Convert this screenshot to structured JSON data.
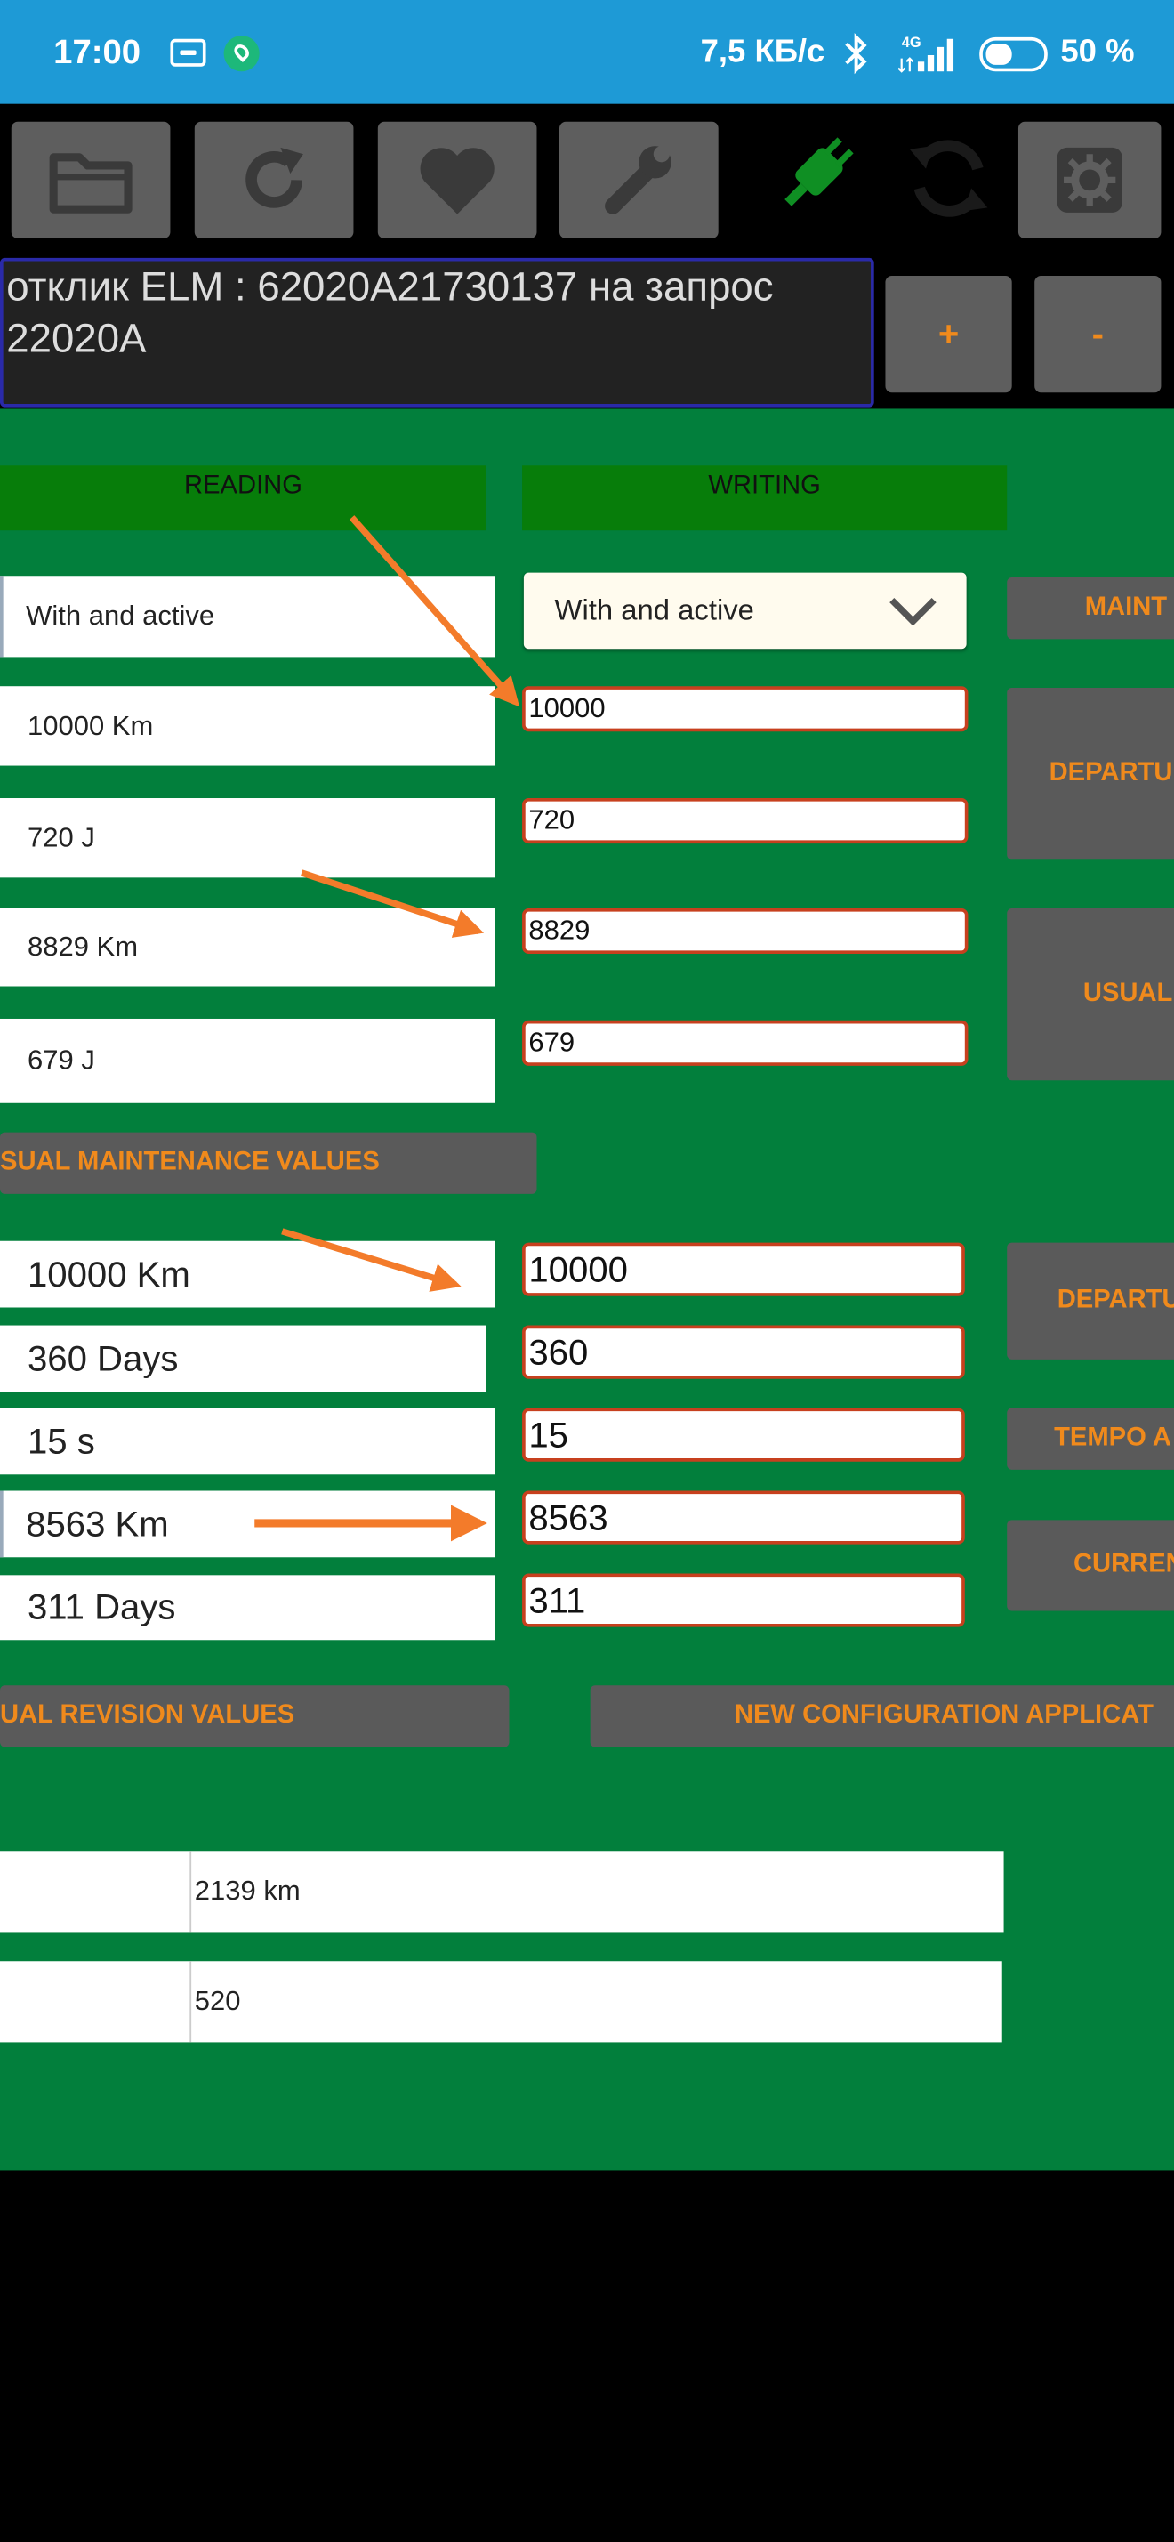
{
  "status_bar": {
    "time": "17:00",
    "net_speed": "7,5 КБ/с",
    "network": "4G",
    "battery": "50 %"
  },
  "console": {
    "line1": "отклик ELM : 62020A21730137 на запрос",
    "line2": "22020A",
    "plus_label": "+",
    "minus_label": "-"
  },
  "headers": {
    "reading": "READING",
    "writing": "WRITING"
  },
  "reading": {
    "mode": "With and active",
    "r1": "10000 Km",
    "r2": "720 J",
    "r3": "8829 Km",
    "r4": "679 J"
  },
  "writing": {
    "mode_select": "With and active",
    "w1": "10000",
    "w2": "720",
    "w3": "8829",
    "w4": "679"
  },
  "side_buttons": {
    "maint": "MAINT",
    "departure1": "DEPARTU",
    "usual": "USUAL",
    "departure2": "DEPARTU",
    "tempo": "TEMPO A",
    "current": "CURREN"
  },
  "usual_maintenance": {
    "label": "SUAL MAINTENANCE VALUES",
    "r1": "10000 Km",
    "r2": "360 Days",
    "r3": "15 s",
    "r4": "8563 Km",
    "r5": "311 Days",
    "w1": "10000",
    "w2": "360",
    "w3": "15",
    "w4": "8563",
    "w5": "311"
  },
  "bottom_buttons": {
    "usual_revision": "UAL REVISION VALUES",
    "new_config": "NEW CONFIGURATION APPLICAT"
  },
  "table": {
    "row1_value": "2139 km",
    "row2_value": "520"
  },
  "colors": {
    "status_bar": "#1e9ad6",
    "content_bg": "#027f3c",
    "header_bg": "#077d0a",
    "button_text": "#f08a1c",
    "input_border": "#c7401e",
    "arrow": "#f37b2a"
  },
  "icons": [
    "folder-icon",
    "refresh-icon",
    "heart-icon",
    "wrench-icon",
    "plug-icon",
    "sync-icon",
    "gear-icon",
    "chevron-down-icon"
  ]
}
